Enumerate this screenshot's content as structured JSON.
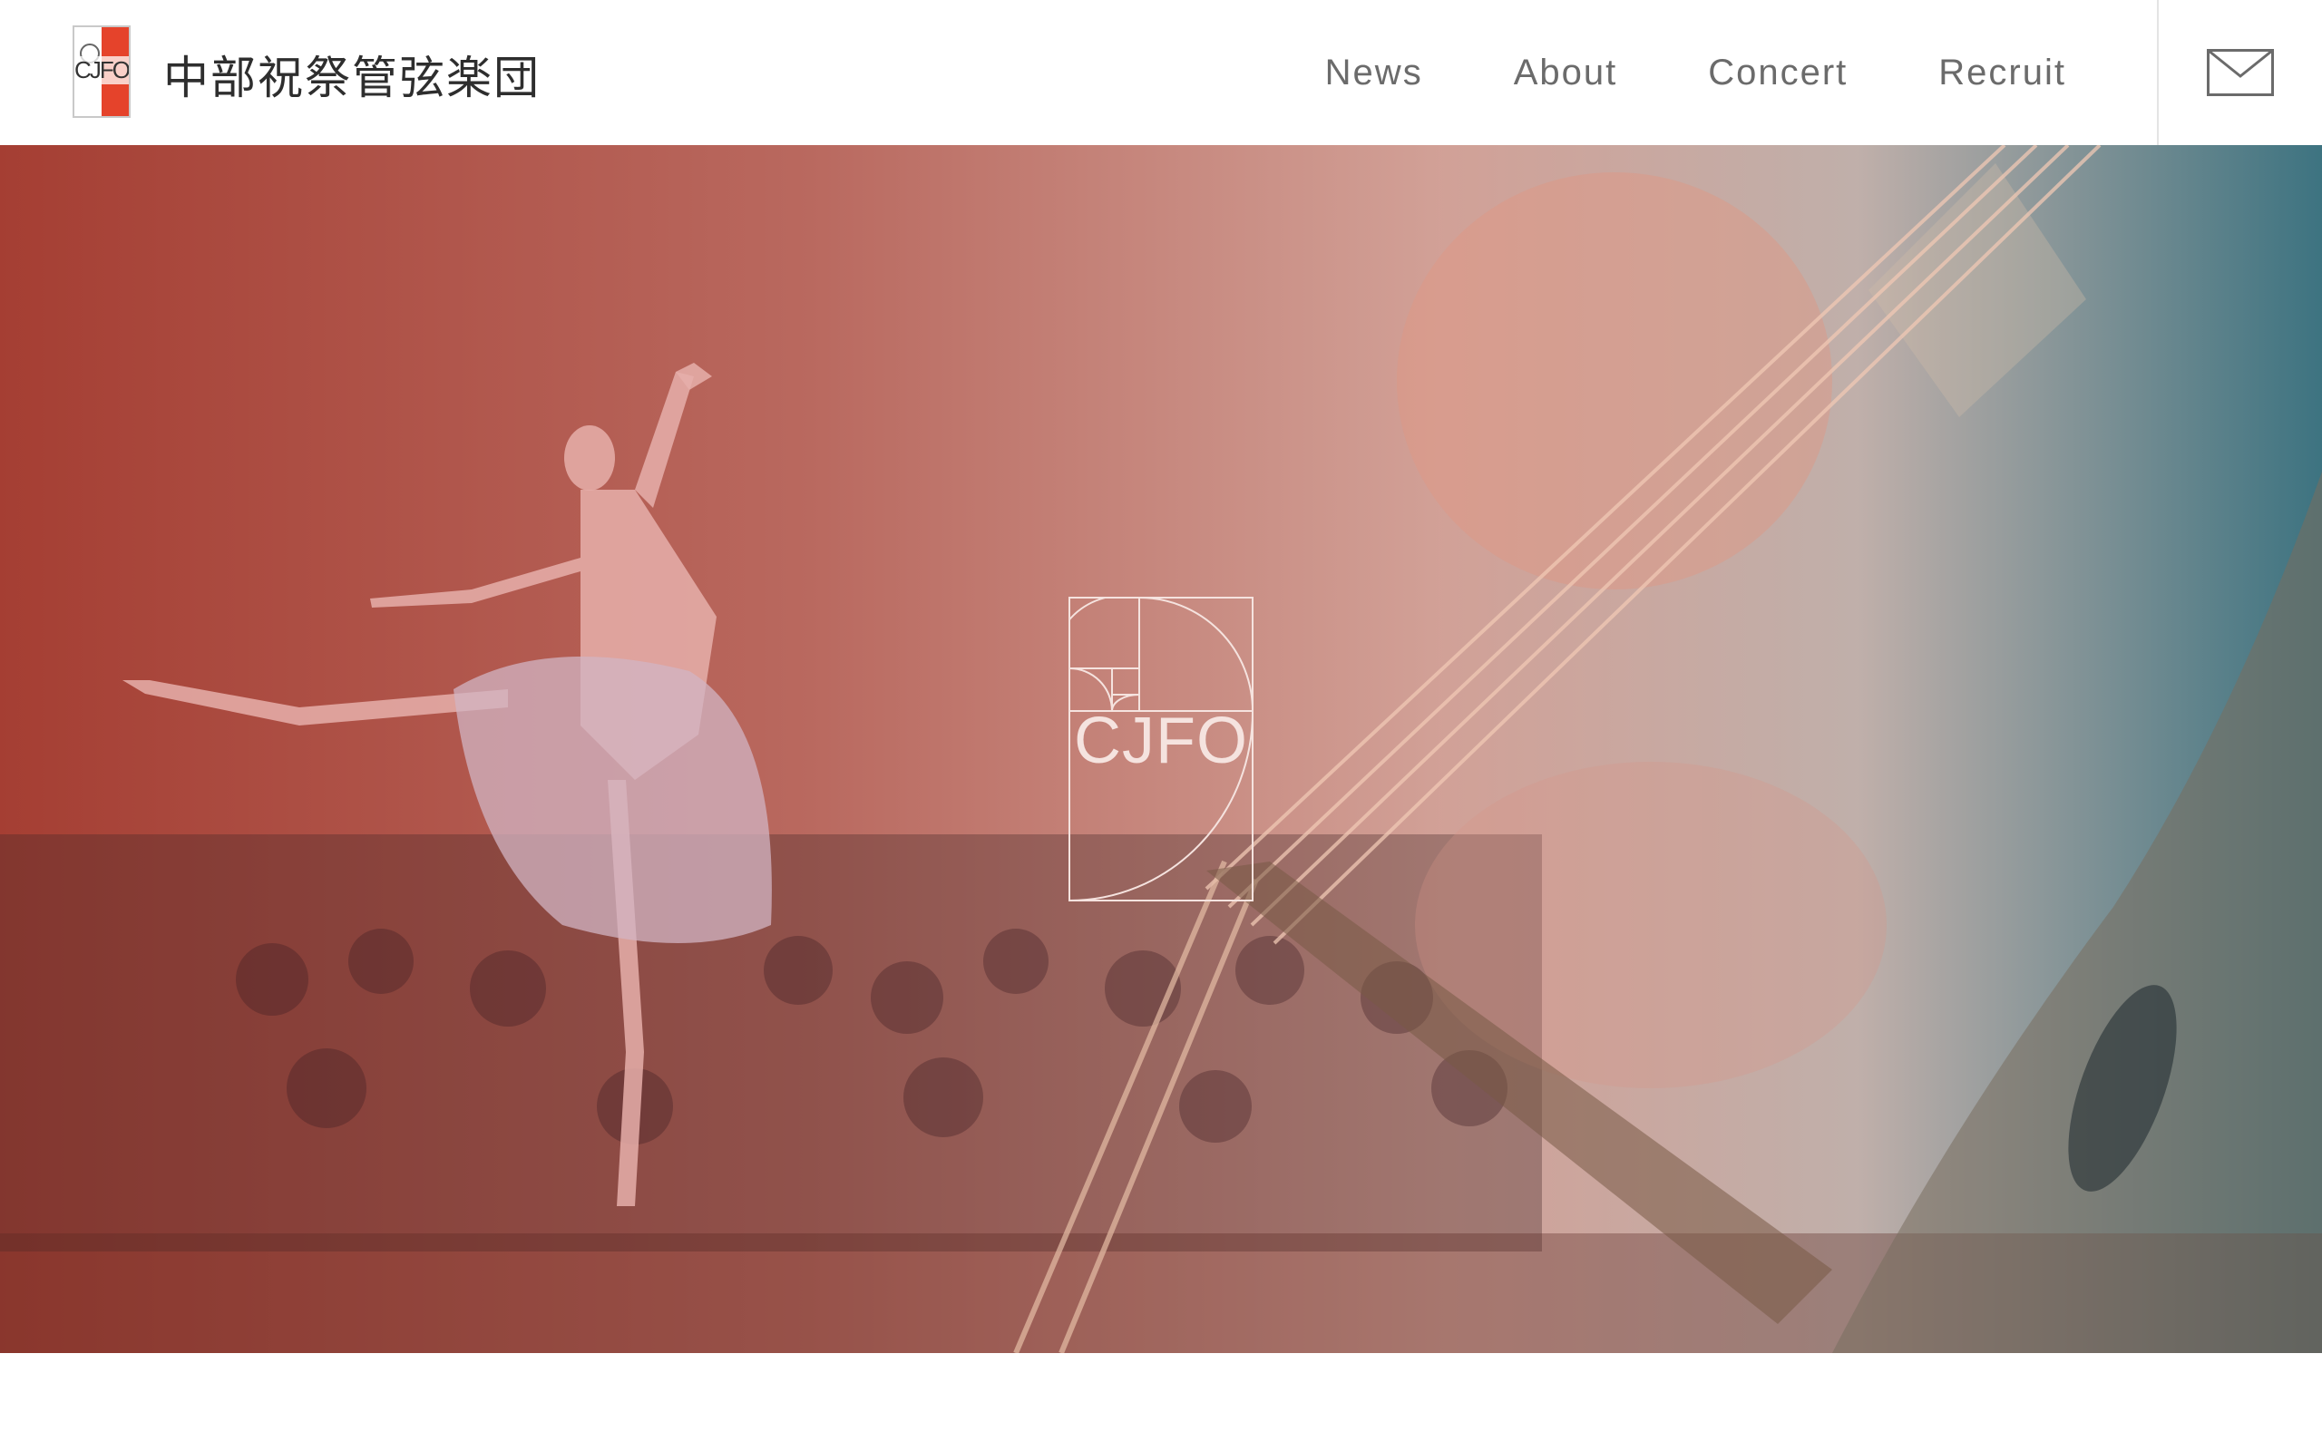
{
  "header": {
    "logo_text": "CJFO",
    "site_title": "中部祝祭管弦楽団",
    "nav": [
      {
        "label": "News"
      },
      {
        "label": "About"
      },
      {
        "label": "Concert"
      },
      {
        "label": "Recruit"
      }
    ],
    "mail_icon": "envelope-icon"
  },
  "hero": {
    "logo_text": "CJFO",
    "logo_icon": "golden-spiral-logo-icon",
    "image_subject": "ballet-dancer-and-cello-over-orchestra",
    "colors": {
      "overlay_left": "#a03428",
      "overlay_right": "#286473"
    }
  },
  "brand": {
    "accent": "#e5432b"
  }
}
